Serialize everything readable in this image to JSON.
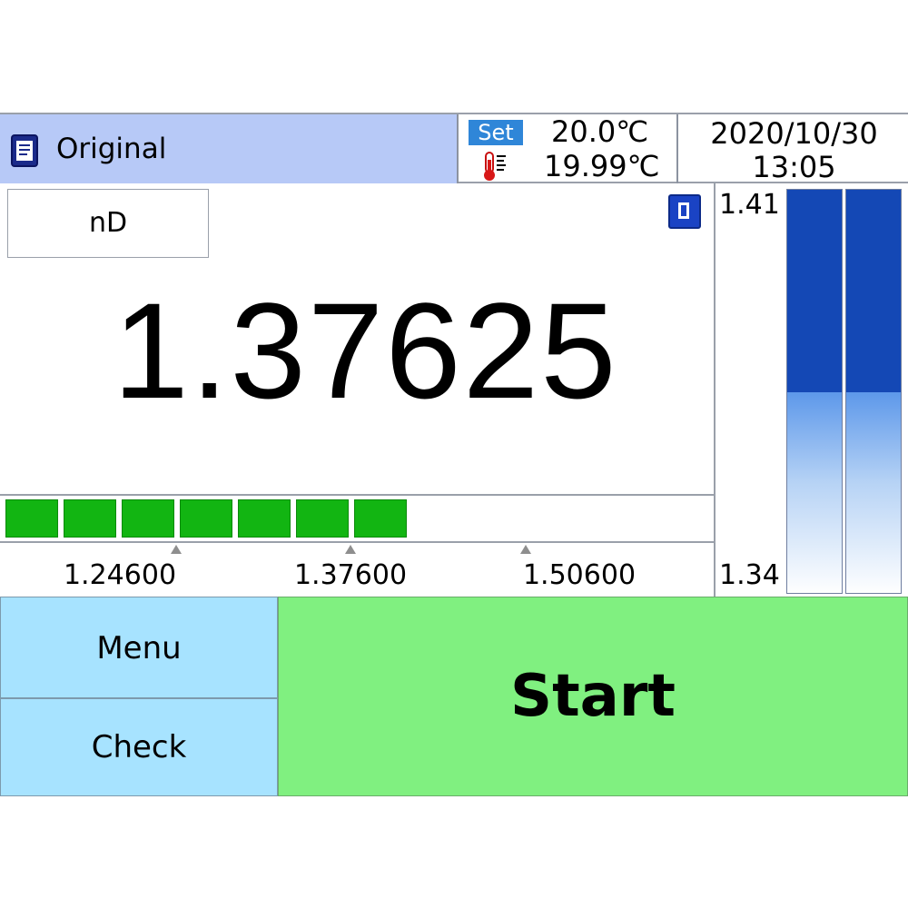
{
  "header": {
    "mode_icon": "document-icon",
    "mode_label": "Original",
    "set_badge": "Set",
    "thermometer_icon": "thermometer-icon",
    "set_temperature": "20.0℃",
    "actual_temperature": "19.99℃",
    "date": "2020/10/30",
    "time": "13:05"
  },
  "reading": {
    "scale_label": "nD",
    "value": "1.37625",
    "hold_icon": "hold-indicator-icon"
  },
  "range_bar": {
    "filled_segments": 7,
    "segment_color": "#12b512",
    "markers": [
      "1.24600",
      "1.37600",
      "1.50600"
    ]
  },
  "gauge": {
    "max_label": "1.41",
    "min_label": "1.34",
    "columns": [
      {
        "fill_fraction": 0.5
      },
      {
        "fill_fraction": 0.5
      }
    ],
    "fill_color": "#1448b5"
  },
  "buttons": {
    "menu": "Menu",
    "check": "Check",
    "start": "Start",
    "start_color": "#80f080",
    "side_color": "#a7e3ff"
  }
}
